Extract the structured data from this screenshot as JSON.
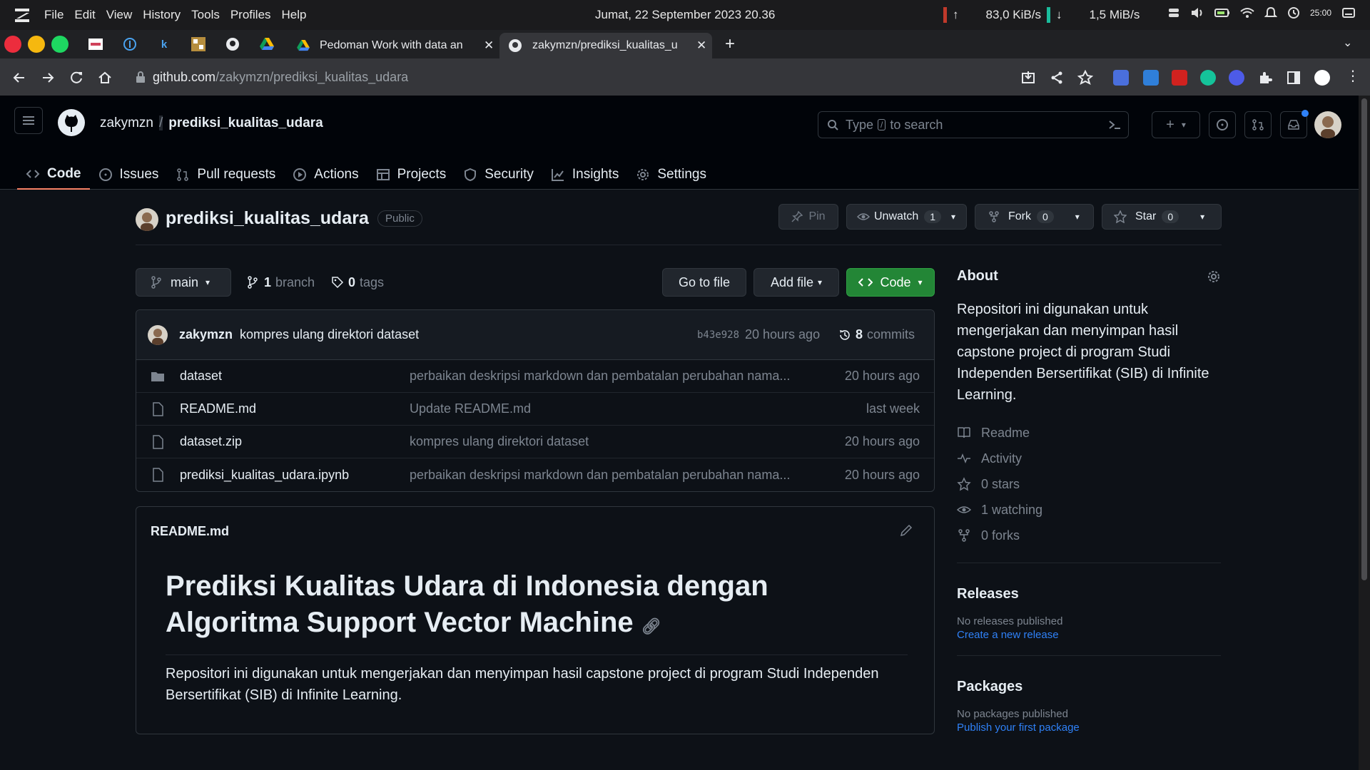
{
  "os": {
    "menus": [
      "File",
      "Edit",
      "View",
      "History",
      "Tools",
      "Profiles",
      "Help"
    ],
    "datetime": "Jumat, 22 September 2023  20.36",
    "upload_speed": "83,0 KiB/s",
    "download_speed": "1,5 MiB/s",
    "clock_label": "25:00"
  },
  "browser": {
    "tabs": [
      {
        "title": "Pedoman Work with data an",
        "active": false
      },
      {
        "title": "zakymzn/prediksi_kualitas_u",
        "active": true
      }
    ],
    "url_host": "github.com",
    "url_path": "/zakymzn/prediksi_kualitas_udara"
  },
  "gh": {
    "owner": "zakymzn",
    "repo": "prediksi_kualitas_udara",
    "search_prefix": "Type",
    "search_key": "/",
    "search_suffix": "to search",
    "tabs": [
      "Code",
      "Issues",
      "Pull requests",
      "Actions",
      "Projects",
      "Security",
      "Insights",
      "Settings"
    ]
  },
  "repo": {
    "name": "prediksi_kualitas_udara",
    "visibility": "Public",
    "pin": "Pin",
    "unwatch": "Unwatch",
    "watch_count": "1",
    "fork": "Fork",
    "fork_count": "0",
    "star": "Star",
    "star_count": "0"
  },
  "bar": {
    "branch": "main",
    "branches_count": "1",
    "branches_label": "branch",
    "tags_count": "0",
    "tags_label": "tags",
    "go_to_file": "Go to file",
    "add_file": "Add file",
    "code": "Code"
  },
  "commit": {
    "author": "zakymzn",
    "message": "kompres ulang direktori dataset",
    "sha": "b43e928",
    "time": "20 hours ago",
    "commits_count": "8",
    "commits_label": "commits"
  },
  "files": [
    {
      "name": "dataset",
      "type": "folder",
      "message": "perbaikan deskripsi markdown dan pembatalan perubahan nama...",
      "time": "20 hours ago"
    },
    {
      "name": "README.md",
      "type": "file",
      "message": "Update README.md",
      "time": "last week"
    },
    {
      "name": "dataset.zip",
      "type": "file",
      "message": "kompres ulang direktori dataset",
      "time": "20 hours ago"
    },
    {
      "name": "prediksi_kualitas_udara.ipynb",
      "type": "file",
      "message": "perbaikan deskripsi markdown dan pembatalan perubahan nama...",
      "time": "20 hours ago"
    }
  ],
  "readme": {
    "filename": "README.md",
    "heading": "Prediksi Kualitas Udara di Indonesia dengan Algoritma Support Vector Machine",
    "body": "Repositori ini digunakan untuk mengerjakan dan menyimpan hasil capstone project di program Studi Independen Bersertifikat (SIB) di Infinite Learning."
  },
  "about": {
    "title": "About",
    "description": "Repositori ini digunakan untuk mengerjakan dan menyimpan hasil capstone project di program Studi Independen Bersertifikat (SIB) di Infinite Learning.",
    "items": [
      "Readme",
      "Activity",
      "0 stars",
      "1 watching",
      "0 forks"
    ],
    "releases_title": "Releases",
    "releases_none": "No releases published",
    "releases_link": "Create a new release",
    "packages_title": "Packages",
    "packages_none": "No packages published",
    "packages_link": "Publish your first package"
  },
  "colors": {
    "bg": "#0d1117",
    "header_bg": "#010409",
    "accent_tab": "#f78166",
    "green": "#238636",
    "link": "#2f81f7"
  }
}
